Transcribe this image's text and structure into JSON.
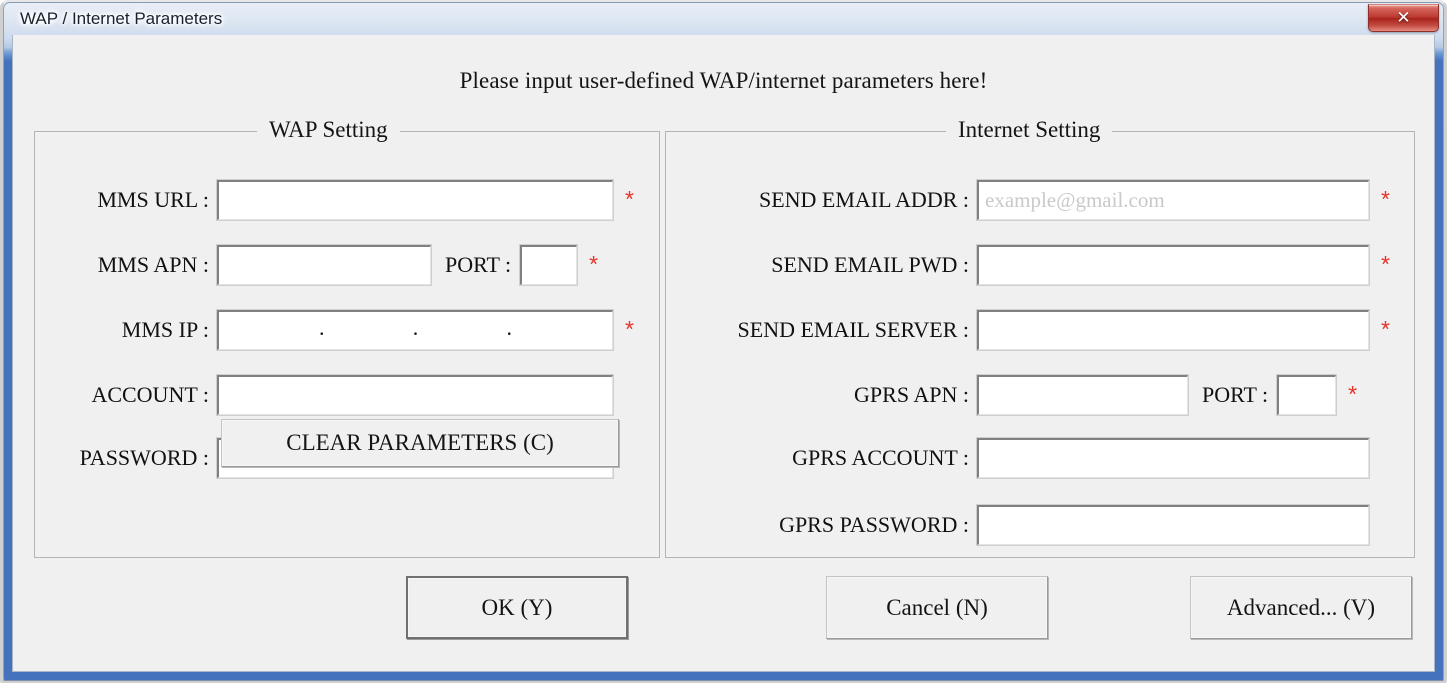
{
  "window": {
    "title": "WAP / Internet Parameters",
    "close_label": "✕",
    "accent_titlebar": "#4572bd",
    "client_bg": "#f0f0f0",
    "required_color": "#e8342b"
  },
  "header": {
    "note": "Please input user-defined WAP/internet parameters here!"
  },
  "wap": {
    "group_title": "WAP Setting",
    "fields": {
      "mms_url_label": "MMS URL :",
      "mms_url_value": "",
      "mms_apn_label": "MMS APN :",
      "mms_apn_value": "",
      "port_label": "PORT :",
      "port_value": "",
      "mms_ip_label": "MMS IP :",
      "mms_ip_seg1": "",
      "mms_ip_seg2": "",
      "mms_ip_seg3": "",
      "mms_ip_seg4": "",
      "ip_dot": ".",
      "account_label": "ACCOUNT :",
      "account_value": "",
      "password_label": "PASSWORD :",
      "password_value": ""
    },
    "clear_button_label": "CLEAR PARAMETERS (C)",
    "required_marker": "*"
  },
  "internet": {
    "group_title": "Internet Setting",
    "fields": {
      "send_email_addr_label": "SEND EMAIL ADDR :",
      "send_email_addr_value": "",
      "send_email_addr_placeholder": "example@gmail.com",
      "send_email_pwd_label": "SEND EMAIL PWD :",
      "send_email_pwd_value": "",
      "send_email_server_label": "SEND EMAIL SERVER :",
      "send_email_server_value": "",
      "gprs_apn_label": "GPRS APN :",
      "gprs_apn_value": "",
      "port_label": "PORT :",
      "port_value": "",
      "gprs_account_label": "GPRS ACCOUNT :",
      "gprs_account_value": "",
      "gprs_password_label": "GPRS PASSWORD :",
      "gprs_password_value": ""
    },
    "required_marker": "*"
  },
  "footer": {
    "ok_label": "OK (Y)",
    "cancel_label": "Cancel (N)",
    "advanced_label": "Advanced... (V)"
  }
}
